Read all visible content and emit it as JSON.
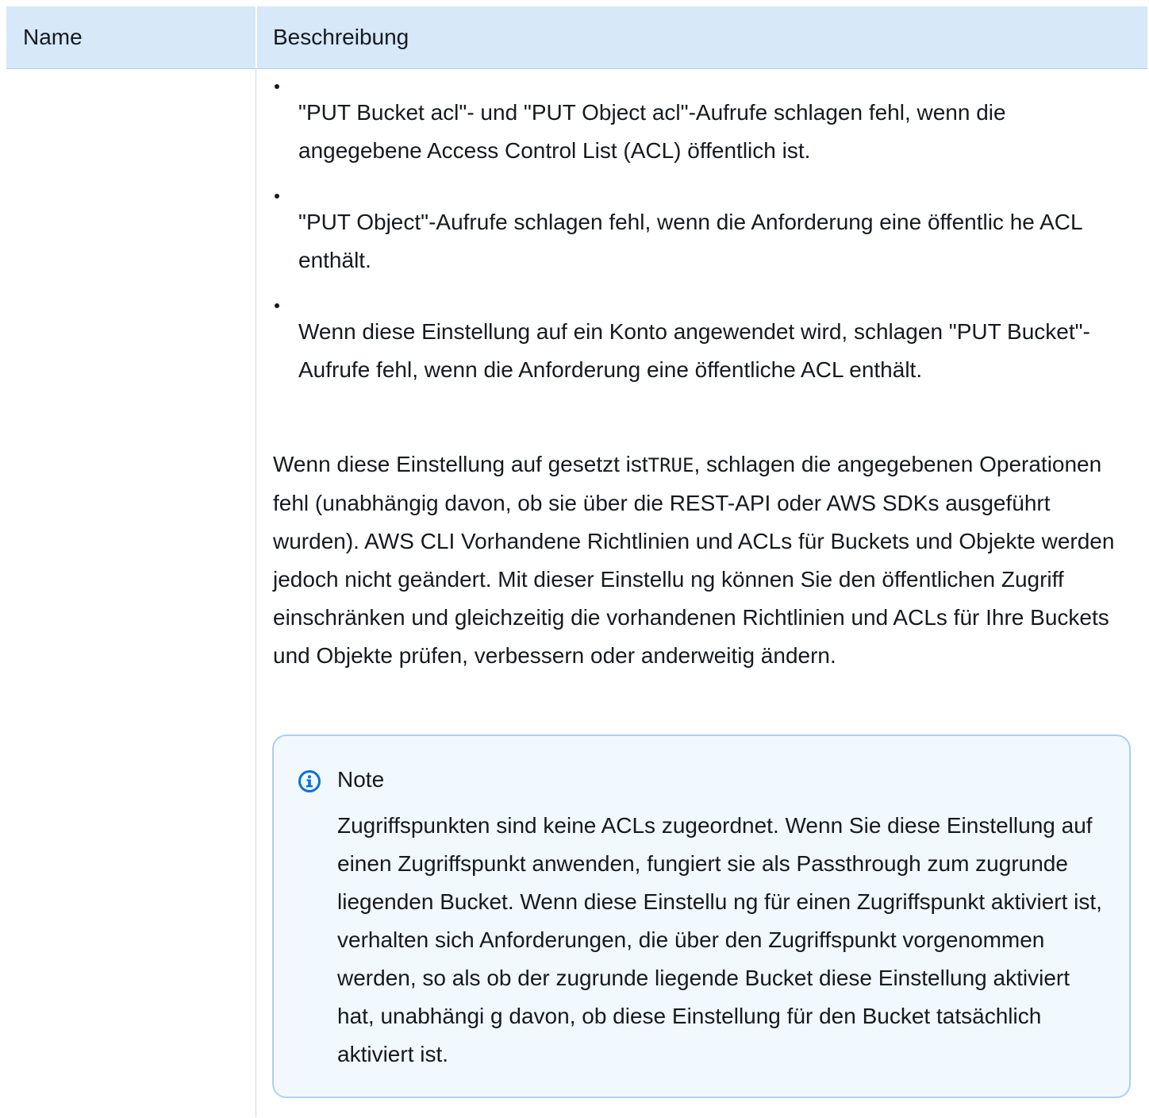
{
  "table": {
    "headers": {
      "name": "Name",
      "description": "Beschreibung"
    },
    "bullets": [
      "\"PUT Bucket acl\"- und \"PUT Object acl\"-Aufrufe schlagen fehl, wenn die angegebene Access Control List (ACL) öffentlich ist.",
      "\"PUT Object\"-Aufrufe schlagen fehl, wenn die Anforderung eine öffentlic he ACL enthält.",
      "Wenn diese Einstellung auf ein Konto angewendet wird, schlagen \"PUT Bucket\"-Aufrufe fehl, wenn die Anforderung eine öffentliche ACL enthält."
    ],
    "paragraph": {
      "before_code": "Wenn diese Einstellung auf gesetzt ist",
      "code": "TRUE",
      "after_code": ", schlagen die angegebenen Operationen fehl (unabhängig davon, ob sie über die REST-API oder AWS SDKs ausgeführt wurden). AWS CLI Vorhandene Richtlinien und ACLs für Buckets und Objekte werden jedoch nicht geändert. Mit dieser Einstellu ng können Sie den öffentlichen Zugriff einschränken und gleichzeitig die vorhandenen Richtlinien und ACLs für Ihre Buckets und Objekte prüfen, verbessern oder anderweitig ändern."
    },
    "note": {
      "icon": "info-icon",
      "title": "Note",
      "text": "Zugriffspunkten sind keine ACLs zugeordnet. Wenn Sie diese Einstellung auf einen Zugriffspunkt anwenden, fungiert sie als Passthrough zum zugrunde liegenden Bucket. Wenn diese Einstellu ng für einen Zugriffspunkt aktiviert ist, verhalten sich Anforderungen, die über den Zugriffspunkt vorgenommen werden, so als ob der zugrunde liegende Bucket diese Einstellung aktiviert hat, unabhängi g davon, ob diese Einstellung für den Bucket tatsächlich aktiviert ist."
    }
  },
  "colors": {
    "header_background": "#d7e8f8",
    "note_background": "#f1f8fe",
    "note_border": "#aed0ef",
    "info_icon": "#0972d3"
  }
}
